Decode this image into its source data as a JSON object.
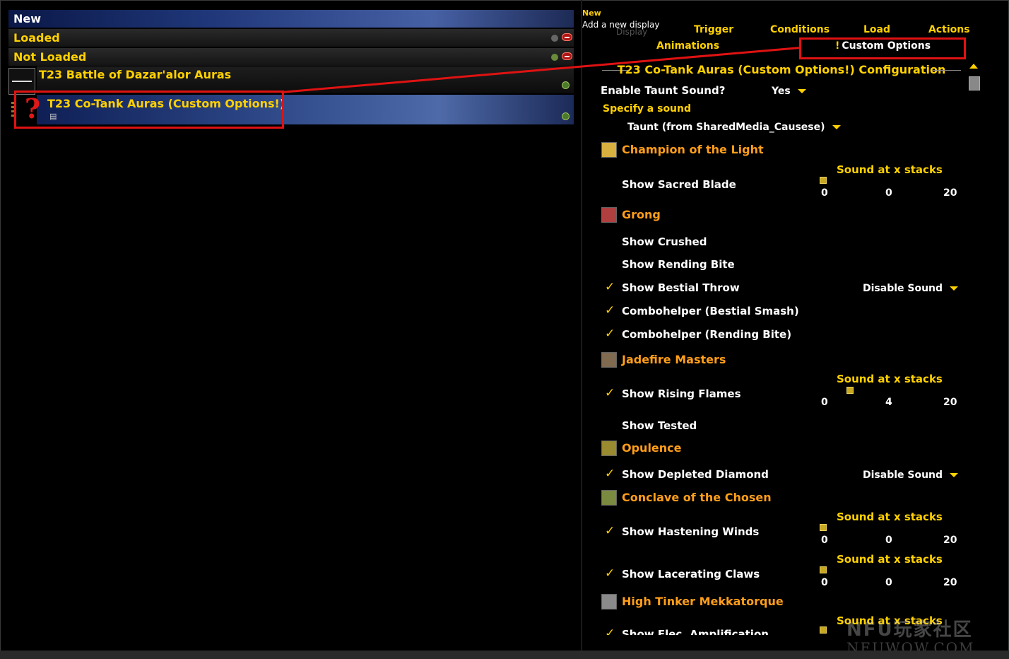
{
  "left": {
    "new": "New",
    "loaded": "Loaded",
    "not_loaded": "Not Loaded",
    "aura_group": "T23 Battle of Dazar'alor Auras",
    "aura_selected": "T23 Co-Tank Auras (Custom Options!)"
  },
  "tooltip": {
    "title": "New",
    "text": "Add a new display",
    "faded": "Display"
  },
  "tabs": {
    "trigger": "Trigger",
    "conditions": "Conditions",
    "load": "Load",
    "actions": "Actions",
    "animations": "Animations",
    "custom_options": "Custom Options"
  },
  "config": {
    "title": "T23 Co-Tank Auras (Custom Options!) Configuration",
    "enable_taunt_label": "Enable Taunt Sound?",
    "enable_taunt_value": "Yes",
    "specify_sound": "Specify a sound",
    "taunt_sound_value": "Taunt (from SharedMedia_Causese)",
    "sound_at_stacks": "Sound at x stacks",
    "disable_sound": "Disable Sound",
    "bosses": [
      {
        "name": "Champion of the Light",
        "icon": "champion-icon",
        "color": "#d8b040"
      },
      {
        "name": "Grong",
        "icon": "grong-icon",
        "color": "#b04040"
      },
      {
        "name": "Jadefire Masters",
        "icon": "jadefire-icon",
        "color": "#806a50"
      },
      {
        "name": "Opulence",
        "icon": "opulence-icon",
        "color": "#9a8a30"
      },
      {
        "name": "Conclave of the Chosen",
        "icon": "conclave-icon",
        "color": "#7a8a40"
      },
      {
        "name": "High Tinker Mekkatorque",
        "icon": "mekkatorque-icon",
        "color": "#8a8a8a"
      }
    ],
    "options": {
      "sacred_blade": "Show Sacred Blade",
      "crushed": "Show Crushed",
      "rending_bite": "Show Rending Bite",
      "bestial_throw": "Show Bestial Throw",
      "combo_bestial": "Combohelper (Bestial Smash)",
      "combo_rending": "Combohelper (Rending Bite)",
      "rising_flames": "Show Rising Flames",
      "tested": "Show Tested",
      "depleted_diamond": "Show Depleted Diamond",
      "hastening_winds": "Show Hastening Winds",
      "lacerating_claws": "Show Lacerating Claws",
      "elec_amplification": "Show Elec. Amplification"
    },
    "sliders": [
      {
        "min": "0",
        "value": "0",
        "max": "20",
        "level": 0
      },
      {
        "min": "0",
        "value": "4",
        "max": "20",
        "level": 0.2
      },
      {
        "min": "0",
        "value": "0",
        "max": "20",
        "level": 0
      },
      {
        "min": "0",
        "value": "0",
        "max": "20",
        "level": 0
      }
    ]
  },
  "watermark": {
    "cn": "NFU玩家社区",
    "en": "NEUWOW.COM"
  },
  "colors": {
    "accent": "#ffd100",
    "boss": "#ff9e1a",
    "highlight": "#e01212"
  }
}
